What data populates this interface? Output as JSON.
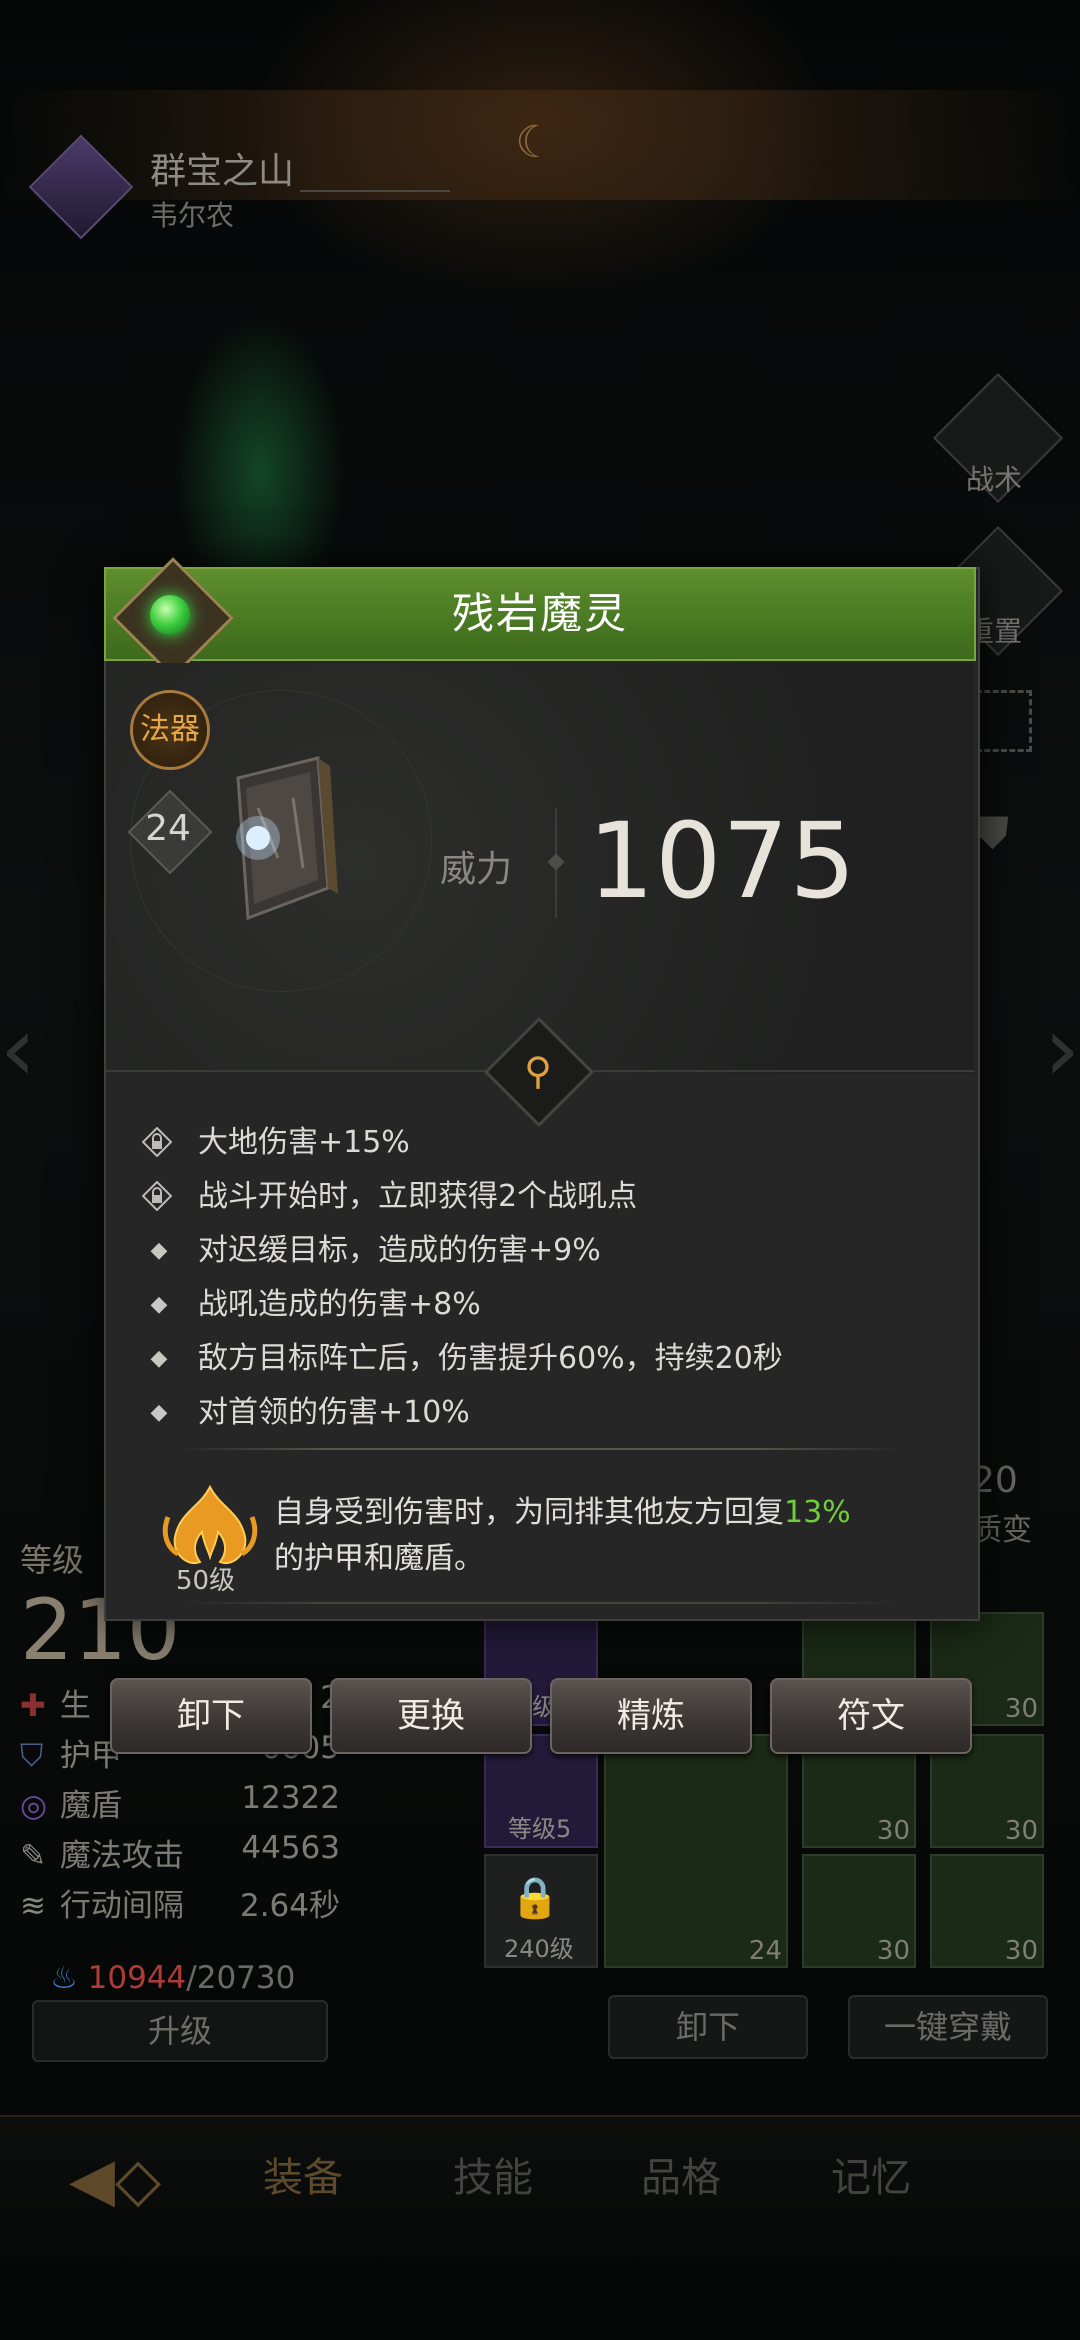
{
  "zone": {
    "title": "群宝之山",
    "subtitle": "韦尔农"
  },
  "side_menu": {
    "tactics": "战术",
    "reset": "重置"
  },
  "hero_panel": {
    "level_label": "等级",
    "level_value": "210",
    "stats": [
      {
        "icon": "health-icon",
        "label": "生",
        "value": "2"
      },
      {
        "icon": "armor-icon",
        "label": "护甲",
        "value": "6605"
      },
      {
        "icon": "magic-shield-icon",
        "label": "魔盾",
        "value": "12322"
      },
      {
        "icon": "magic-attack-icon",
        "label": "魔法攻击",
        "value": "44563"
      },
      {
        "icon": "action-interval-icon",
        "label": "行动间隔",
        "value": "2.64秒"
      }
    ],
    "energy_current": "10944",
    "energy_max": "/20730",
    "upgrade_label": "升级"
  },
  "equipment_grid": {
    "slot_labels": [
      "等级5",
      "等级5",
      "240级"
    ],
    "slot_levels": [
      "24",
      "30",
      "30",
      "30",
      "30",
      "30",
      "30"
    ],
    "transform_count": "20",
    "transform_label": "质变",
    "unequip_label": "卸下",
    "equip_all_label": "一键穿戴"
  },
  "bottom_nav": {
    "tabs": [
      {
        "label": "装备",
        "active": true
      },
      {
        "label": "技能",
        "active": false
      },
      {
        "label": "品格",
        "active": false
      },
      {
        "label": "记忆",
        "active": false
      }
    ]
  },
  "item_popup": {
    "name": "残岩魔灵",
    "type_badge": "法器",
    "level": "24",
    "power_label": "威力",
    "power_value": "1075",
    "header_color": "#4f8526",
    "attributes": [
      {
        "locked": true,
        "text": "大地伤害+15%"
      },
      {
        "locked": true,
        "text": "战斗开始时，立即获得2个战吼点"
      },
      {
        "locked": false,
        "text": "对迟缓目标，造成的伤害+9%"
      },
      {
        "locked": false,
        "text": "战吼造成的伤害+8%"
      },
      {
        "locked": false,
        "text": "敌方目标阵亡后，伤害提升60%，持续20秒"
      },
      {
        "locked": false,
        "text": "对首领的伤害+10%"
      }
    ],
    "special": {
      "level": "50级",
      "text_before": "自身受到伤害时，为同排其他友方回复",
      "highlight": "13%",
      "text_after": "的护甲和魔盾。",
      "highlight_color": "#6fcf3a"
    },
    "actions": {
      "unequip": "卸下",
      "replace": "更换",
      "refine": "精炼",
      "rune": "符文"
    }
  }
}
